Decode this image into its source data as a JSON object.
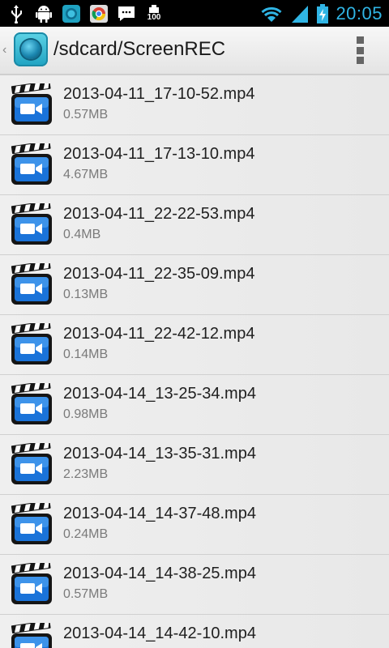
{
  "status_bar": {
    "icons_left": [
      "usb-icon",
      "android-debug-icon",
      "screenrec-app-icon",
      "chrome-icon",
      "message-icon",
      "battery-100-icon"
    ],
    "battery_label": "100",
    "time": "20:05"
  },
  "action_bar": {
    "title": "/sdcard/ScreenREC"
  },
  "files": [
    {
      "name": "2013-04-11_17-10-52.mp4",
      "size": "0.57MB"
    },
    {
      "name": "2013-04-11_17-13-10.mp4",
      "size": "4.67MB"
    },
    {
      "name": "2013-04-11_22-22-53.mp4",
      "size": "0.4MB"
    },
    {
      "name": "2013-04-11_22-35-09.mp4",
      "size": "0.13MB"
    },
    {
      "name": "2013-04-11_22-42-12.mp4",
      "size": "0.14MB"
    },
    {
      "name": "2013-04-14_13-25-34.mp4",
      "size": "0.98MB"
    },
    {
      "name": "2013-04-14_13-35-31.mp4",
      "size": "2.23MB"
    },
    {
      "name": "2013-04-14_14-37-48.mp4",
      "size": "0.24MB"
    },
    {
      "name": "2013-04-14_14-38-25.mp4",
      "size": "0.57MB"
    },
    {
      "name": "2013-04-14_14-42-10.mp4",
      "size": ""
    }
  ],
  "colors": {
    "time": "#30b5e5",
    "wifi": "#30b5e5",
    "clapper_blue": "#1a73d9"
  }
}
